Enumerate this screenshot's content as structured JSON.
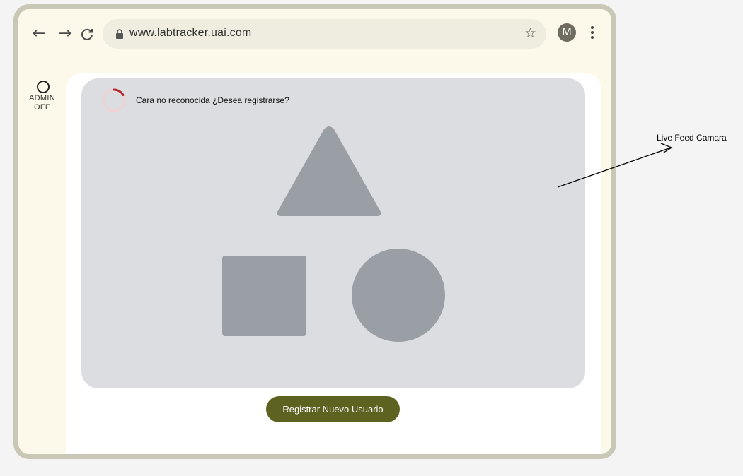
{
  "browser": {
    "url": "www.labtracker.uai.com",
    "back_glyph": "←",
    "forward_glyph": "→",
    "reload_glyph": "C",
    "star_glyph": "☆",
    "avatar_initial": "M"
  },
  "sidebar": {
    "admin_label": "ADMIN",
    "admin_state": "OFF"
  },
  "camera": {
    "status_message": "Cara no reconocida ¿Desea registrarse?",
    "register_button_label": "Registrar Nuevo Usuario"
  },
  "annotation": {
    "label": "Live Feed Camara"
  },
  "colors": {
    "frame": "#c9c8b6",
    "browser_bg": "#fcf9ea",
    "camera_bg": "#dcdde0",
    "placeholder_shape": "#9a9ea5",
    "button_bg": "#5e6221",
    "spinner_accent": "#b3262d"
  }
}
